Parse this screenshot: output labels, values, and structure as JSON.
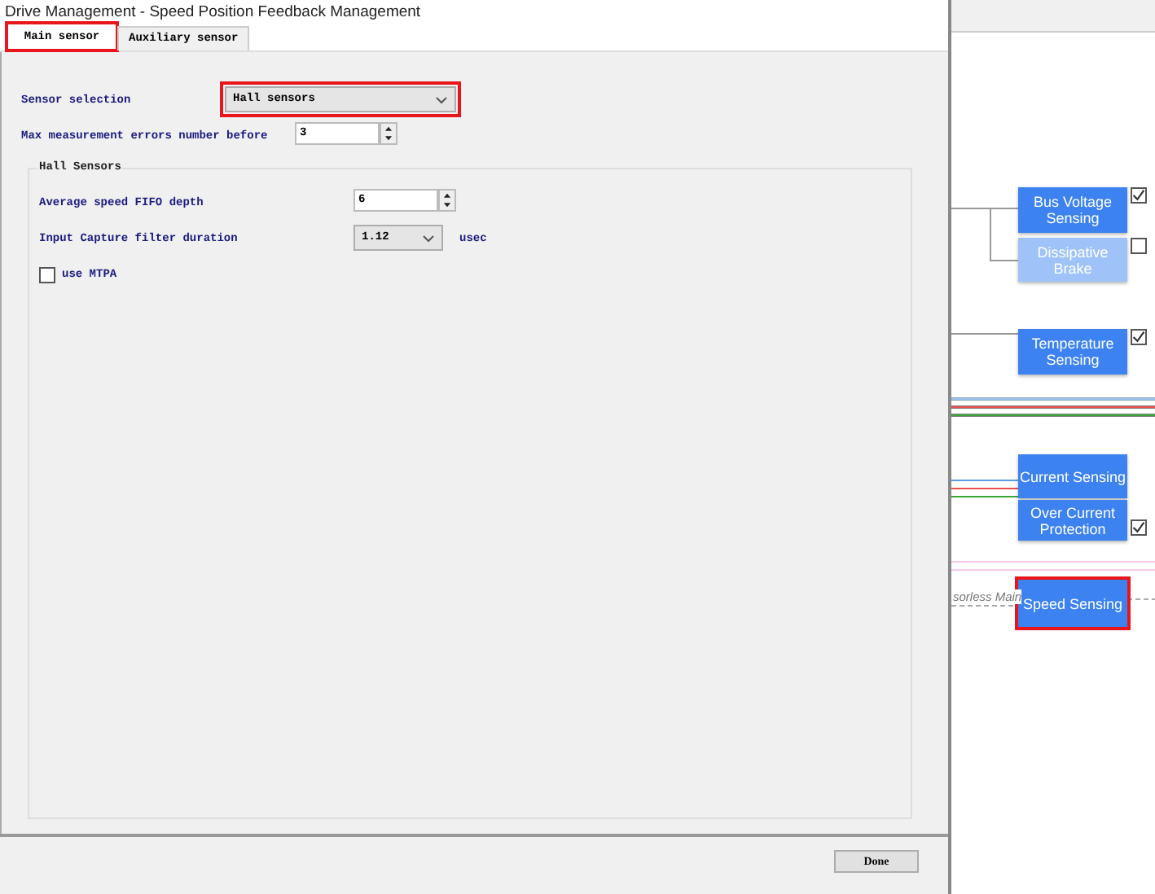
{
  "window": {
    "title": "Drive Management - Speed Position Feedback Management"
  },
  "tabs": [
    {
      "label": "Main sensor",
      "selected": true,
      "highlighted": true
    },
    {
      "label": "Auxiliary sensor",
      "selected": false,
      "highlighted": false
    }
  ],
  "fields": [
    {
      "kind": "select",
      "label": "Sensor selection",
      "value": "Hall sensors",
      "highlighted": true
    },
    {
      "kind": "spin",
      "label": "Max measurement errors number before",
      "value": "3"
    }
  ],
  "group": {
    "title": "Hall Sensors",
    "fields": [
      {
        "kind": "spin",
        "label": "Average speed FIFO depth",
        "value": "6"
      },
      {
        "kind": "select",
        "label": "Input Capture filter duration",
        "value": "1.12",
        "unit": "usec"
      },
      {
        "kind": "checkbox",
        "label": "use MTPA",
        "checked": false
      }
    ]
  },
  "buttons": [
    {
      "label": "Done"
    }
  ],
  "diagram": {
    "partial_label": "sorless Main",
    "blocks": [
      {
        "label": "Bus Voltage Sensing",
        "enabled": true,
        "checked": true,
        "highlighted": false
      },
      {
        "label": "Dissipative Brake",
        "enabled": false,
        "checked": false,
        "highlighted": false
      },
      {
        "label": "Temperature Sensing",
        "enabled": true,
        "checked": true,
        "highlighted": false
      },
      {
        "label": "Current Sensing",
        "enabled": true,
        "highlighted": false
      },
      {
        "label": "Over Current Protection",
        "enabled": true,
        "checked": true,
        "highlighted": false
      },
      {
        "label": "Speed Sensing",
        "enabled": true,
        "highlighted": true
      }
    ]
  }
}
